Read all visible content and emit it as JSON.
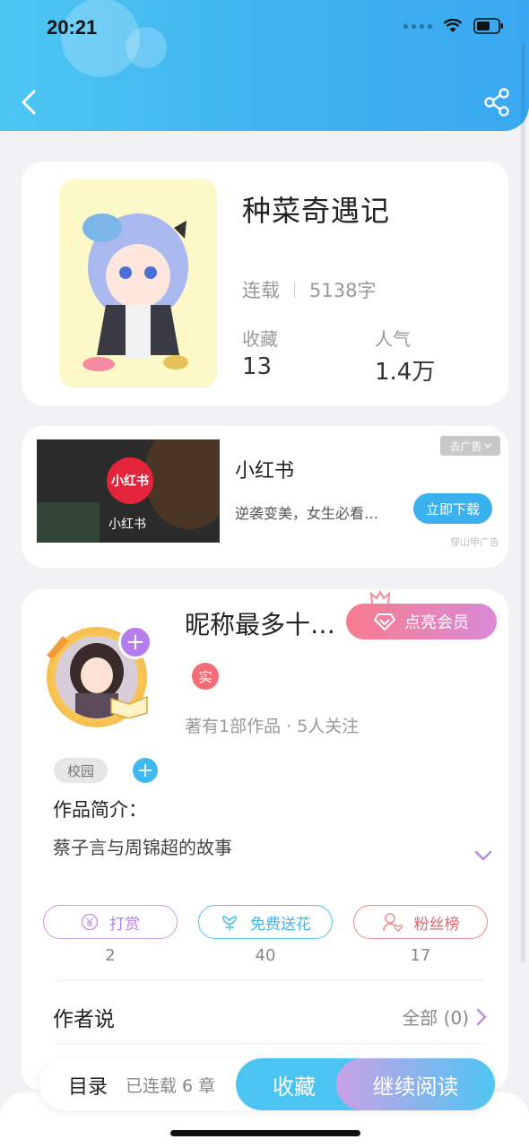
{
  "status_bar": {
    "time": "20:21"
  },
  "book": {
    "title": "种菜奇遇记",
    "status": "连载",
    "word_count": "5138字",
    "favorites_label": "收藏",
    "favorites_value": "13",
    "popularity_label": "人气",
    "popularity_value": "1.4万"
  },
  "ad": {
    "logo_text": "小红书",
    "image_caption": "小红书",
    "title": "小红书",
    "description": "逆袭变美，女生必看…",
    "download_label": "立即下载",
    "close_label": "去广告",
    "source": "穿山甲广告"
  },
  "author": {
    "name": "昵称最多十…",
    "vip_label": "点亮会员",
    "real_badge": "实",
    "meta": "著有1部作品 · 5人关注",
    "tag": "校园",
    "intro_label": "作品简介：",
    "intro_text": "蔡子言与周锦超的故事"
  },
  "actions": [
    {
      "label": "打赏",
      "count": "2",
      "color": "#c89ae6"
    },
    {
      "label": "免费送花",
      "count": "40",
      "color": "#4cc4f2"
    },
    {
      "label": "粉丝榜",
      "count": "17",
      "color": "#f08c8c"
    }
  ],
  "author_says": {
    "label": "作者说",
    "all_label": "全部 (0)"
  },
  "bottom_bar": {
    "toc_label": "目录",
    "toc_status": "已连载 6 章",
    "favorite_label": "收藏",
    "continue_label": "继续阅读"
  },
  "colors": {
    "header_blue": "#3fb4f0",
    "accent_purple": "#b57cec",
    "accent_pink": "#f26d75"
  }
}
